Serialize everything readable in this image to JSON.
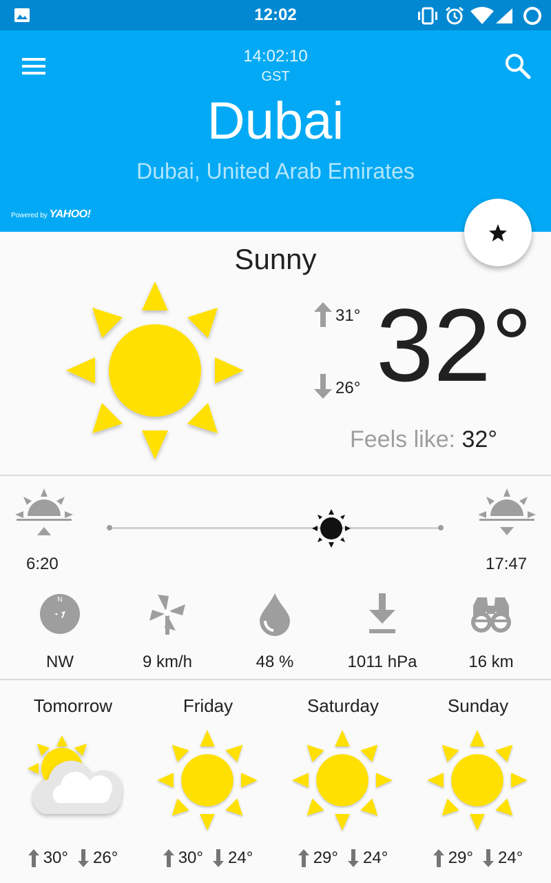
{
  "status_bar": {
    "time": "12:02"
  },
  "header": {
    "local_time": "14:02:10",
    "timezone": "GST",
    "city": "Dubai",
    "region": "Dubai, United Arab Emirates",
    "powered_prefix": "Powered by",
    "powered_brand": "YAHOO!"
  },
  "current": {
    "condition": "Sunny",
    "temperature": "32°",
    "high": "31°",
    "low": "26°",
    "feels_label": "Feels like:",
    "feels_value": "32°",
    "icon": "sun-icon"
  },
  "sun": {
    "sunrise": "6:20",
    "sunset": "17:47",
    "day_progress": 0.67
  },
  "details": [
    {
      "name": "wind-direction",
      "icon": "compass-icon",
      "value": "NW"
    },
    {
      "name": "wind-speed",
      "icon": "windmill-icon",
      "value": "9 km/h"
    },
    {
      "name": "humidity",
      "icon": "drop-icon",
      "value": "48 %"
    },
    {
      "name": "pressure",
      "icon": "pressure-arrow-icon",
      "value": "1011 hPa"
    },
    {
      "name": "visibility",
      "icon": "binoculars-icon",
      "value": "16 km"
    }
  ],
  "forecast": [
    {
      "day": "Tomorrow",
      "icon": "partly-cloudy-icon",
      "high": "30°",
      "low": "26°"
    },
    {
      "day": "Friday",
      "icon": "sun-icon",
      "high": "30°",
      "low": "24°"
    },
    {
      "day": "Saturday",
      "icon": "sun-icon",
      "high": "29°",
      "low": "24°"
    },
    {
      "day": "Sunday",
      "icon": "sun-icon",
      "high": "29°",
      "low": "24°"
    }
  ],
  "colors": {
    "header": "#03a9f4",
    "status_bar": "#0288d1",
    "sun": "#ffe000",
    "grey_icon": "#9e9e9e"
  }
}
